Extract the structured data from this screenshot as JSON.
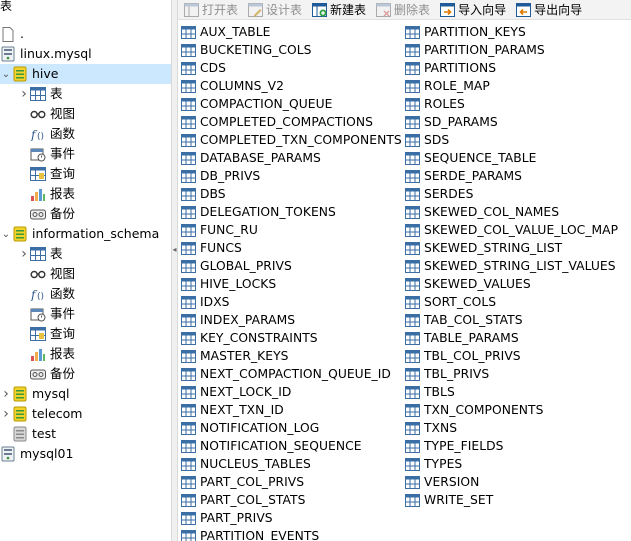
{
  "sidebar": {
    "top_stub_text": "表",
    "items": [
      {
        "kind": "plain",
        "icon": "document-icon",
        "label": "."
      },
      {
        "kind": "conn",
        "icon": "connection-icon",
        "label": "linux.mysql"
      },
      {
        "kind": "db",
        "icon": "database-icon",
        "label": "hive",
        "selected": true,
        "expanded": true
      },
      {
        "kind": "child",
        "icon": "table-folder-icon",
        "label": "表",
        "caret": true
      },
      {
        "kind": "child",
        "icon": "view-icon",
        "label": "视图"
      },
      {
        "kind": "child",
        "icon": "function-icon",
        "label": "函数"
      },
      {
        "kind": "child",
        "icon": "event-icon",
        "label": "事件"
      },
      {
        "kind": "child",
        "icon": "query-icon",
        "label": "查询"
      },
      {
        "kind": "child",
        "icon": "report-icon",
        "label": "报表"
      },
      {
        "kind": "child",
        "icon": "backup-icon",
        "label": "备份"
      },
      {
        "kind": "db",
        "icon": "database-icon",
        "label": "information_schema",
        "expanded": true
      },
      {
        "kind": "child",
        "icon": "table-folder-icon",
        "label": "表",
        "caret": true
      },
      {
        "kind": "child",
        "icon": "view-icon",
        "label": "视图"
      },
      {
        "kind": "child",
        "icon": "function-icon",
        "label": "函数"
      },
      {
        "kind": "child",
        "icon": "event-icon",
        "label": "事件"
      },
      {
        "kind": "child",
        "icon": "query-icon",
        "label": "查询"
      },
      {
        "kind": "child",
        "icon": "report-icon",
        "label": "报表"
      },
      {
        "kind": "child",
        "icon": "backup-icon",
        "label": "备份"
      },
      {
        "kind": "db",
        "icon": "database-icon",
        "label": "mysql",
        "caret": true
      },
      {
        "kind": "db",
        "icon": "database-icon",
        "label": "telecom",
        "caret": true
      },
      {
        "kind": "db",
        "icon": "database-gray-icon",
        "label": "test"
      },
      {
        "kind": "conn",
        "icon": "connection-icon",
        "label": "mysql01"
      }
    ]
  },
  "toolbar": {
    "buttons": [
      {
        "name": "open-table-button",
        "icon": "open-table-icon",
        "label": "打开表",
        "enabled": false
      },
      {
        "name": "design-table-button",
        "icon": "design-table-icon",
        "label": "设计表",
        "enabled": false
      },
      {
        "name": "new-table-button",
        "icon": "new-table-icon",
        "label": "新建表",
        "enabled": true
      },
      {
        "name": "delete-table-button",
        "icon": "delete-table-icon",
        "label": "删除表",
        "enabled": false
      },
      {
        "name": "import-wizard-button",
        "icon": "import-wizard-icon",
        "label": "导入向导",
        "enabled": true
      },
      {
        "name": "export-wizard-button",
        "icon": "export-wizard-icon",
        "label": "导出向导",
        "enabled": true
      }
    ]
  },
  "tables": {
    "column1": [
      "AUX_TABLE",
      "BUCKETING_COLS",
      "CDS",
      "COLUMNS_V2",
      "COMPACTION_QUEUE",
      "COMPLETED_COMPACTIONS",
      "COMPLETED_TXN_COMPONENTS",
      "DATABASE_PARAMS",
      "DB_PRIVS",
      "DBS",
      "DELEGATION_TOKENS",
      "FUNC_RU",
      "FUNCS",
      "GLOBAL_PRIVS",
      "HIVE_LOCKS",
      "IDXS",
      "INDEX_PARAMS",
      "KEY_CONSTRAINTS",
      "MASTER_KEYS",
      "NEXT_COMPACTION_QUEUE_ID",
      "NEXT_LOCK_ID",
      "NEXT_TXN_ID",
      "NOTIFICATION_LOG",
      "NOTIFICATION_SEQUENCE",
      "NUCLEUS_TABLES",
      "PART_COL_PRIVS",
      "PART_COL_STATS",
      "PART_PRIVS",
      "PARTITION_EVENTS"
    ],
    "column2": [
      "PARTITION_KEYS",
      "PARTITION_PARAMS",
      "PARTITIONS",
      "ROLE_MAP",
      "ROLES",
      "SD_PARAMS",
      "SDS",
      "SEQUENCE_TABLE",
      "SERDE_PARAMS",
      "SERDES",
      "SKEWED_COL_NAMES",
      "SKEWED_COL_VALUE_LOC_MAP",
      "SKEWED_STRING_LIST",
      "SKEWED_STRING_LIST_VALUES",
      "SKEWED_VALUES",
      "SORT_COLS",
      "TAB_COL_STATS",
      "TABLE_PARAMS",
      "TBL_COL_PRIVS",
      "TBL_PRIVS",
      "TBLS",
      "TXN_COMPONENTS",
      "TXNS",
      "TYPE_FIELDS",
      "TYPES",
      "VERSION",
      "WRITE_SET"
    ]
  },
  "colors": {
    "selection": "#cce8ff",
    "db_green": "#f2c200",
    "table_icon_blue": "#3a6ea5"
  }
}
